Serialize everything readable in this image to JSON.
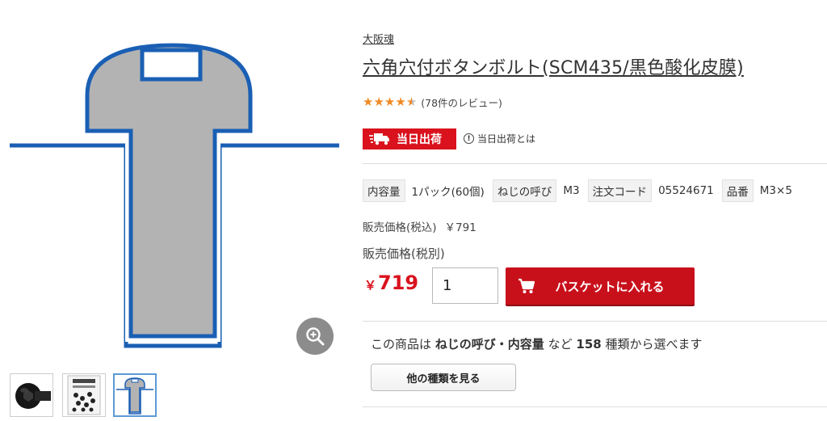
{
  "gallery": {
    "main_image_icon": "screw-cross-section-diagram",
    "zoom_icon": "zoom-in-icon",
    "thumbnails": [
      {
        "icon": "black-button-bolt-photo"
      },
      {
        "icon": "package-photo"
      },
      {
        "icon": "screw-diagram-thumbnail"
      }
    ]
  },
  "product": {
    "brand": "大阪魂",
    "title": "六角穴付ボタンボルト(SCM435/黒色酸化皮膜)",
    "rating": {
      "value": 4.5,
      "max": 5,
      "review_text": "(78件のレビュー)"
    },
    "shipping": {
      "badge": "当日出荷",
      "help_text": "当日出荷とは",
      "badge_color": "#d9121d"
    },
    "specs": [
      {
        "label": "内容量",
        "value": "1パック(60個)"
      },
      {
        "label": "ねじの呼び",
        "value": "M3"
      },
      {
        "label": "注文コード",
        "value": "05524671"
      },
      {
        "label": "品番",
        "value": "M3×5"
      }
    ],
    "price_inc_label": "販売価格(税込)",
    "price_inc_value": "￥791",
    "price_ex_label": "販売価格(税別)",
    "price_currency": "￥",
    "price_ex_value": "719",
    "price_color": "#d9121d",
    "quantity": "1",
    "cart_button": "バスケットに入れる",
    "variant": {
      "prefix": "この商品は",
      "attributes": "ねじの呼び・内容量",
      "middle": "など",
      "count": "158",
      "suffix": "種類から選べます",
      "button": "他の種類を見る"
    }
  }
}
